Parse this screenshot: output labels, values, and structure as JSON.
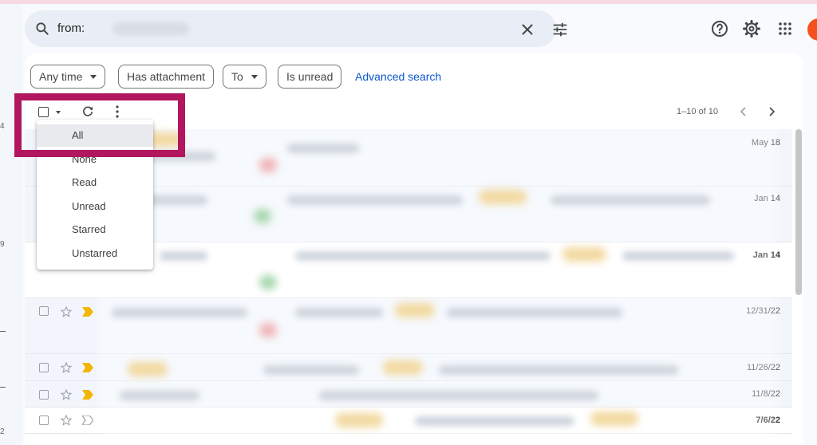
{
  "search": {
    "query": "from:"
  },
  "filters": {
    "any_time": "Any time",
    "has_attachment": "Has attachment",
    "to": "To",
    "is_unread": "Is unread",
    "advanced_search": "Advanced search"
  },
  "toolbar": {
    "page_count": "1–10 of 10"
  },
  "select_menu": {
    "items": [
      "All",
      "None",
      "Read",
      "Unread",
      "Starred",
      "Unstarred"
    ]
  },
  "rows": [
    {
      "date": "May 18",
      "unread": false
    },
    {
      "date": "Jan 14",
      "unread": false
    },
    {
      "date": "Jan 14",
      "unread": true
    },
    {
      "date": "12/31/22",
      "unread": false
    },
    {
      "date": "11/26/22",
      "unread": false
    },
    {
      "date": "11/8/22",
      "unread": false
    },
    {
      "date": "7/6/22",
      "unread": true
    }
  ],
  "left_edge": {
    "num1": "4",
    "num2": "9",
    "num3": "2"
  },
  "colors": {
    "accent": "#0b57d0",
    "highlight": "#b2165e",
    "important_marker": "#f2b600",
    "avatar": "#f4511e"
  },
  "icons": [
    "search-icon",
    "clear-icon",
    "tune-icon",
    "help-icon",
    "settings-icon",
    "apps-icon",
    "refresh-icon",
    "more-vert-icon",
    "chevron-left-icon",
    "chevron-right-icon",
    "star-icon",
    "important-icon"
  ]
}
